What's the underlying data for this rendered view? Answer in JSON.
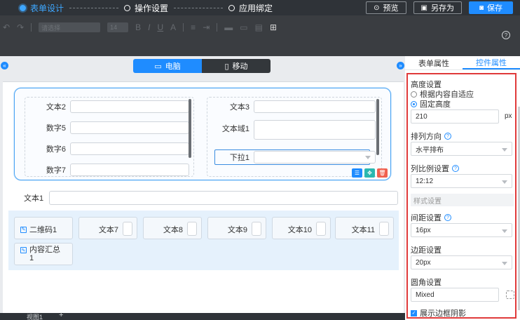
{
  "steps": [
    {
      "label": "表单设计",
      "active": true
    },
    {
      "label": "操作设置",
      "active": false
    },
    {
      "label": "应用绑定",
      "active": false
    }
  ],
  "top_actions": {
    "preview": "预览",
    "save_as": "另存为",
    "save": "保存"
  },
  "toolbar": {
    "font_family": "请选择",
    "font_size": "14"
  },
  "device_tabs": {
    "desktop": "电脑",
    "mobile": "移动"
  },
  "block1": {
    "col1": [
      "文本2",
      "数字5",
      "数字6",
      "数字7"
    ],
    "col2": [
      "文本3",
      "文本域1",
      "下拉1"
    ]
  },
  "text1_label": "文本1",
  "group2": {
    "cells": [
      {
        "label": "二维码1",
        "type": "icon"
      },
      {
        "label": "文本7",
        "type": "text"
      },
      {
        "label": "文本8",
        "type": "text"
      },
      {
        "label": "文本9",
        "type": "text"
      },
      {
        "label": "文本10",
        "type": "text"
      },
      {
        "label": "文本11",
        "type": "text"
      },
      {
        "label": "内容汇总\n1",
        "type": "icon"
      }
    ]
  },
  "bottom_tabs": {
    "view": "视图1",
    "add": "+"
  },
  "right_panel": {
    "tabs": [
      "表单属性",
      "控件属性"
    ],
    "active_tab": 1,
    "height_title": "高度设置",
    "height_options": [
      "根据内容自适应",
      "固定高度"
    ],
    "height_selected": 1,
    "height_value": "210",
    "height_unit": "px",
    "direction_title": "排列方向",
    "direction_value": "水平排布",
    "ratio_title": "列比例设置",
    "ratio_value": "12:12",
    "style_section": "样式设置",
    "gap_title": "间距设置",
    "gap_value": "16px",
    "margin_title": "边距设置",
    "margin_value": "20px",
    "radius_title": "圆角设置",
    "radius_value": "Mixed",
    "shadow_label": "展示边框阴影",
    "shadow_checked": true
  },
  "colors": {
    "accent": "#1f8cff",
    "highlight_border": "#e03a3a",
    "topbar_bg": "#2f3338"
  }
}
